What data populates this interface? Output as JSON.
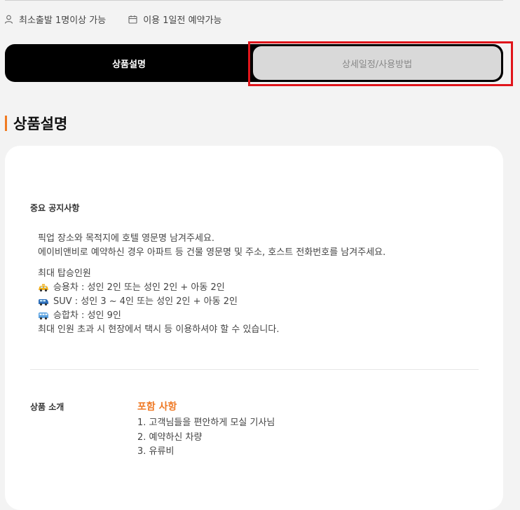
{
  "info": {
    "min_departure": "최소출발 1명이상 가능",
    "booking": "이용 1일전 예약가능"
  },
  "tabs": [
    {
      "label": "상품설명",
      "active": true
    },
    {
      "label": "상세일정/사용방법",
      "active": false
    }
  ],
  "section_title": "상품설명",
  "notice": {
    "label": "중요 공지사항",
    "line1": "픽업 장소와 목적지에 호텔 영문명 남겨주세요.",
    "line2": "에이비앤비로 예약하신 경우 아파트 등 건물 영문명 및 주소, 호스트 전화번호를 남겨주세요.",
    "capacity_title": "최대 탑승인원",
    "vehicles": [
      {
        "icon": "taxi-icon",
        "text": "승용차 : 성인 2인 또는 성인 2인 + 아동 2인"
      },
      {
        "icon": "suv-icon",
        "text": "SUV : 성인 3 ~ 4인 또는 성인 2인 + 아동 2인"
      },
      {
        "icon": "van-icon",
        "text": "승합차 : 성인 9인"
      }
    ],
    "footer": "최대 인원 초과 시 현장에서 택시 등 이용하셔야 할 수 있습니다."
  },
  "intro": {
    "label": "상품 소개",
    "include_title": "포함 사항",
    "items": [
      "1. 고객님들을 편안하게 모실 기사님",
      "2. 예약하신 차량",
      "3. 유류비"
    ]
  },
  "colors": {
    "accent": "#ef7a26",
    "highlight": "#e0151b"
  }
}
